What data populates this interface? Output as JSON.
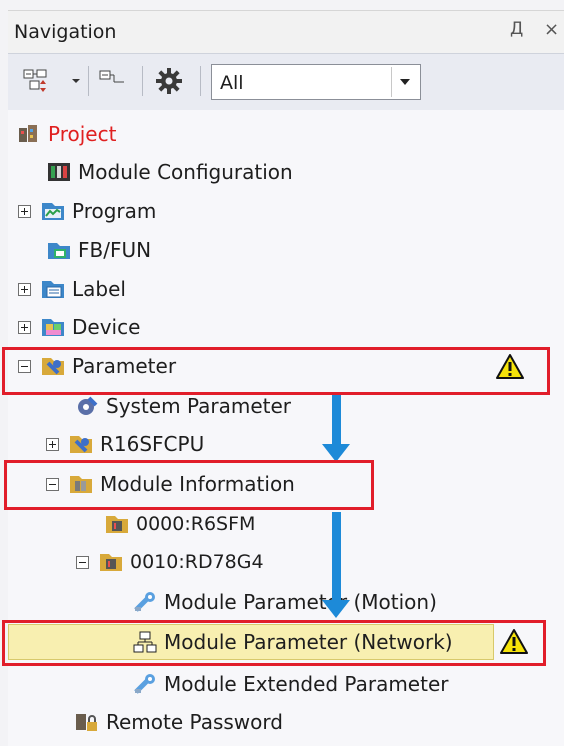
{
  "panel": {
    "title": "Navigation",
    "pin_glyph": "Д",
    "close_glyph": "×"
  },
  "toolbar": {
    "filter_value": "All",
    "buttons": [
      "expand-collapse-icon",
      "tree-view-icon",
      "gear-icon"
    ]
  },
  "tree": {
    "project": "Project",
    "module_configuration": "Module Configuration",
    "program": "Program",
    "fb_fun": "FB/FUN",
    "label": "Label",
    "device": "Device",
    "parameter": "Parameter",
    "system_parameter": "System Parameter",
    "cpu": "R16SFCPU",
    "module_information": "Module Information",
    "module_0000": "0000:R6SFM",
    "module_0010": "0010:RD78G4",
    "module_parameter_motion": "Module Parameter (Motion)",
    "module_parameter_network": "Module Parameter (Network)",
    "module_extended_parameter": "Module Extended Parameter",
    "remote_password": "Remote Password"
  },
  "colors": {
    "project_text": "#e02020",
    "annotation_red": "#e11d2a",
    "arrow_blue": "#1d8ad8",
    "selected_bg": "#f8efb0",
    "warning_yellow": "#f5e30a"
  }
}
